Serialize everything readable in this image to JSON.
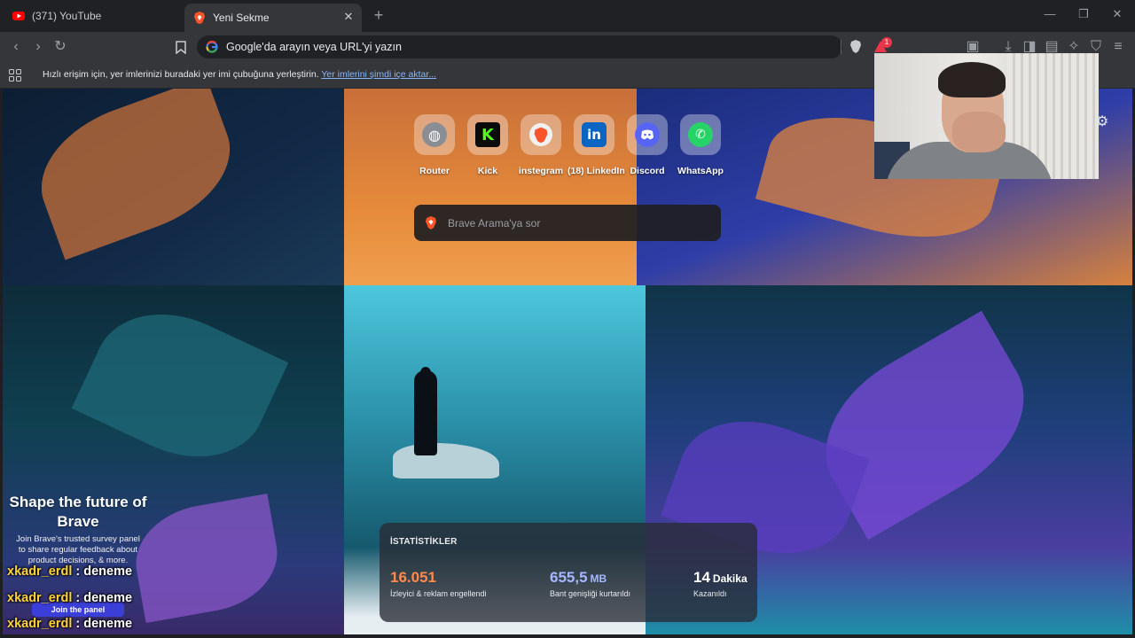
{
  "tabs": [
    {
      "title": "(371) YouTube",
      "icon": "youtube-icon",
      "active": false
    },
    {
      "title": "Yeni Sekme",
      "icon": "brave-icon",
      "active": true
    }
  ],
  "toolbar": {
    "omnibox_text": "Google'da arayın veya URL'yi yazın",
    "rewards_badge": "1"
  },
  "bookmarks_bar": {
    "hint_text": "Hızlı erişim için, yer imlerinizi buradaki yer imi çubuğuna yerleştirin. ",
    "import_link": "Yer imlerini şimdi içe aktar..."
  },
  "top_sites": [
    {
      "label": "Router",
      "icon": "globe-icon"
    },
    {
      "label": "Kick",
      "icon": "kick-icon"
    },
    {
      "label": "instegram",
      "icon": "brave-icon"
    },
    {
      "label": "(18) LinkedIn",
      "icon": "linkedin-icon"
    },
    {
      "label": "Discord",
      "icon": "discord-icon"
    },
    {
      "label": "WhatsApp",
      "icon": "whatsapp-icon"
    }
  ],
  "search": {
    "placeholder": "Brave Arama'ya sor"
  },
  "stats": {
    "title": "İSTATİSTİKLER",
    "items": [
      {
        "value": "16.051",
        "unit": "",
        "label": "İzleyici & reklam engellendi",
        "color": "#ff8a4c"
      },
      {
        "value": "655,5",
        "unit": "MB",
        "label": "Bant genişliği kurtarıldı",
        "color": "#a6b8ff"
      },
      {
        "value": "14",
        "unit": "Dakika",
        "label": "Kazanıldı",
        "color": "#ffffff"
      }
    ]
  },
  "promo_card": {
    "title": "Shape the future of Brave",
    "body": "Join Brave's trusted survey panel to share regular feedback about product decisions, & more.",
    "button": "Join the panel"
  },
  "chat": [
    {
      "user": "xkadr_erdl",
      "sep": " : ",
      "message": "deneme"
    },
    {
      "user": "xkadr_erdl",
      "sep": " : ",
      "message": "deneme"
    },
    {
      "user": "xkadr_erdl",
      "sep": " : ",
      "message": "deneme"
    }
  ],
  "colors": {
    "accent_orange": "#ff8a4c",
    "accent_blue": "#a6b8ff",
    "link": "#8ab4f8",
    "chat_user": "#ffd23a"
  }
}
